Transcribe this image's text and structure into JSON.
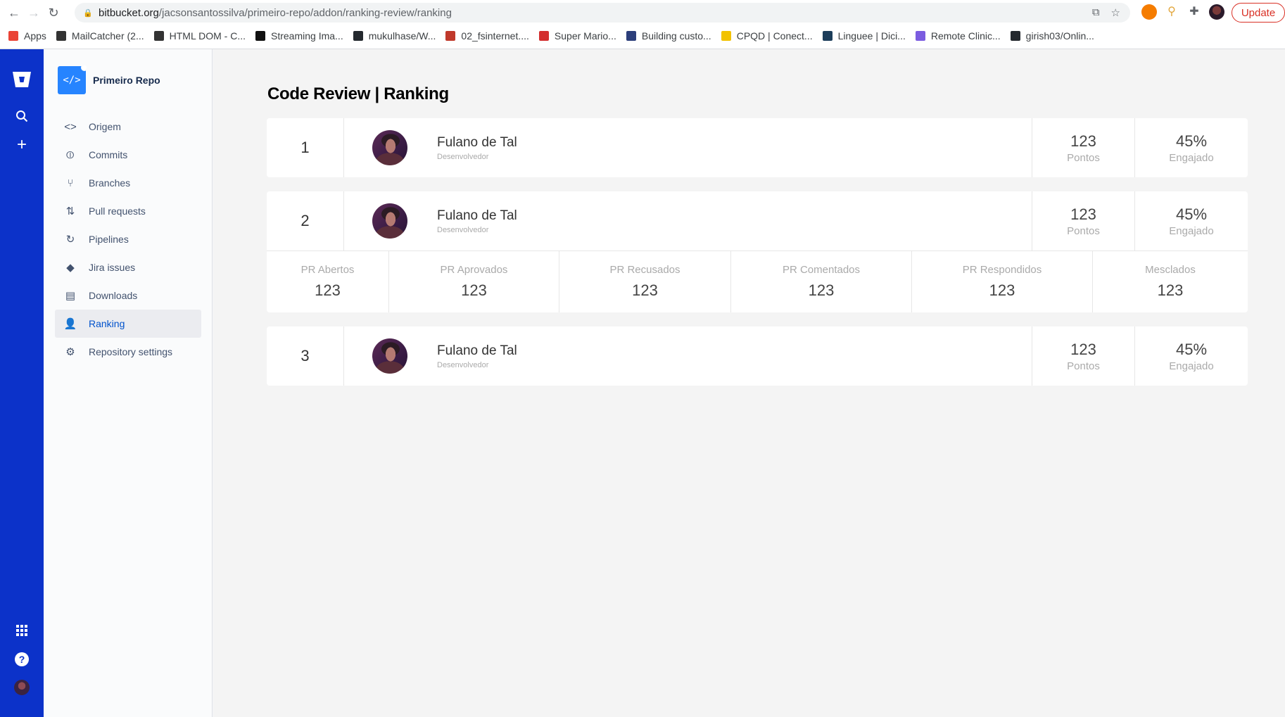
{
  "browser": {
    "url_host": "bitbucket.org",
    "url_path": "/jacsonsantossilva/primeiro-repo/addon/ranking-review/ranking",
    "update_label": "Update",
    "bookmarks": [
      {
        "label": "Apps",
        "color": "#ea4335"
      },
      {
        "label": "MailCatcher (2...",
        "color": "#333333"
      },
      {
        "label": "HTML DOM - C...",
        "color": "#333333"
      },
      {
        "label": "Streaming Ima...",
        "color": "#111111"
      },
      {
        "label": "mukulhase/W...",
        "color": "#24292e"
      },
      {
        "label": "02_fsinternet....",
        "color": "#c0392b"
      },
      {
        "label": "Super Mario...",
        "color": "#d32f2f"
      },
      {
        "label": "Building custo...",
        "color": "#2c3e7a"
      },
      {
        "label": "CPQD | Conect...",
        "color": "#f2c200"
      },
      {
        "label": "Linguee | Dici...",
        "color": "#1c3d5a"
      },
      {
        "label": "Remote Clinic...",
        "color": "#7b5ce0"
      },
      {
        "label": "girish03/Onlin...",
        "color": "#24292e"
      }
    ]
  },
  "gnav": {
    "icons": [
      "bitbucket-logo",
      "search-icon",
      "plus-icon",
      "apps-grid-icon",
      "help-icon",
      "avatar"
    ]
  },
  "sidebar": {
    "repo_name": "Primeiro Repo",
    "items": [
      {
        "label": "Origem",
        "icon": "<>"
      },
      {
        "label": "Commits",
        "icon": "⦶"
      },
      {
        "label": "Branches",
        "icon": "⑂"
      },
      {
        "label": "Pull requests",
        "icon": "⇅"
      },
      {
        "label": "Pipelines",
        "icon": "↻"
      },
      {
        "label": "Jira issues",
        "icon": "◆"
      },
      {
        "label": "Downloads",
        "icon": "▤"
      },
      {
        "label": "Ranking",
        "icon": "👤"
      },
      {
        "label": "Repository settings",
        "icon": "⚙"
      }
    ]
  },
  "main": {
    "title": "Code Review | Ranking",
    "entries": [
      {
        "rank": "1",
        "name": "Fulano de Tal",
        "role": "Desenvolvedor",
        "points": "123",
        "points_label": "Pontos",
        "engagement": "45%",
        "engagement_label": "Engajado"
      },
      {
        "rank": "2",
        "name": "Fulano de Tal",
        "role": "Desenvolvedor",
        "points": "123",
        "points_label": "Pontos",
        "engagement": "45%",
        "engagement_label": "Engajado",
        "details": [
          {
            "label": "PR Abertos",
            "value": "123"
          },
          {
            "label": "PR Aprovados",
            "value": "123"
          },
          {
            "label": "PR Recusados",
            "value": "123"
          },
          {
            "label": "PR Comentados",
            "value": "123"
          },
          {
            "label": "PR Respondidos",
            "value": "123"
          },
          {
            "label": "Mesclados",
            "value": "123"
          }
        ]
      },
      {
        "rank": "3",
        "name": "Fulano de Tal",
        "role": "Desenvolvedor",
        "points": "123",
        "points_label": "Pontos",
        "engagement": "45%",
        "engagement_label": "Engajado"
      }
    ]
  },
  "colors": {
    "gnav_bg": "#0c32c9",
    "active_item": "#0052cc",
    "repo_avatar": "#2684ff"
  }
}
